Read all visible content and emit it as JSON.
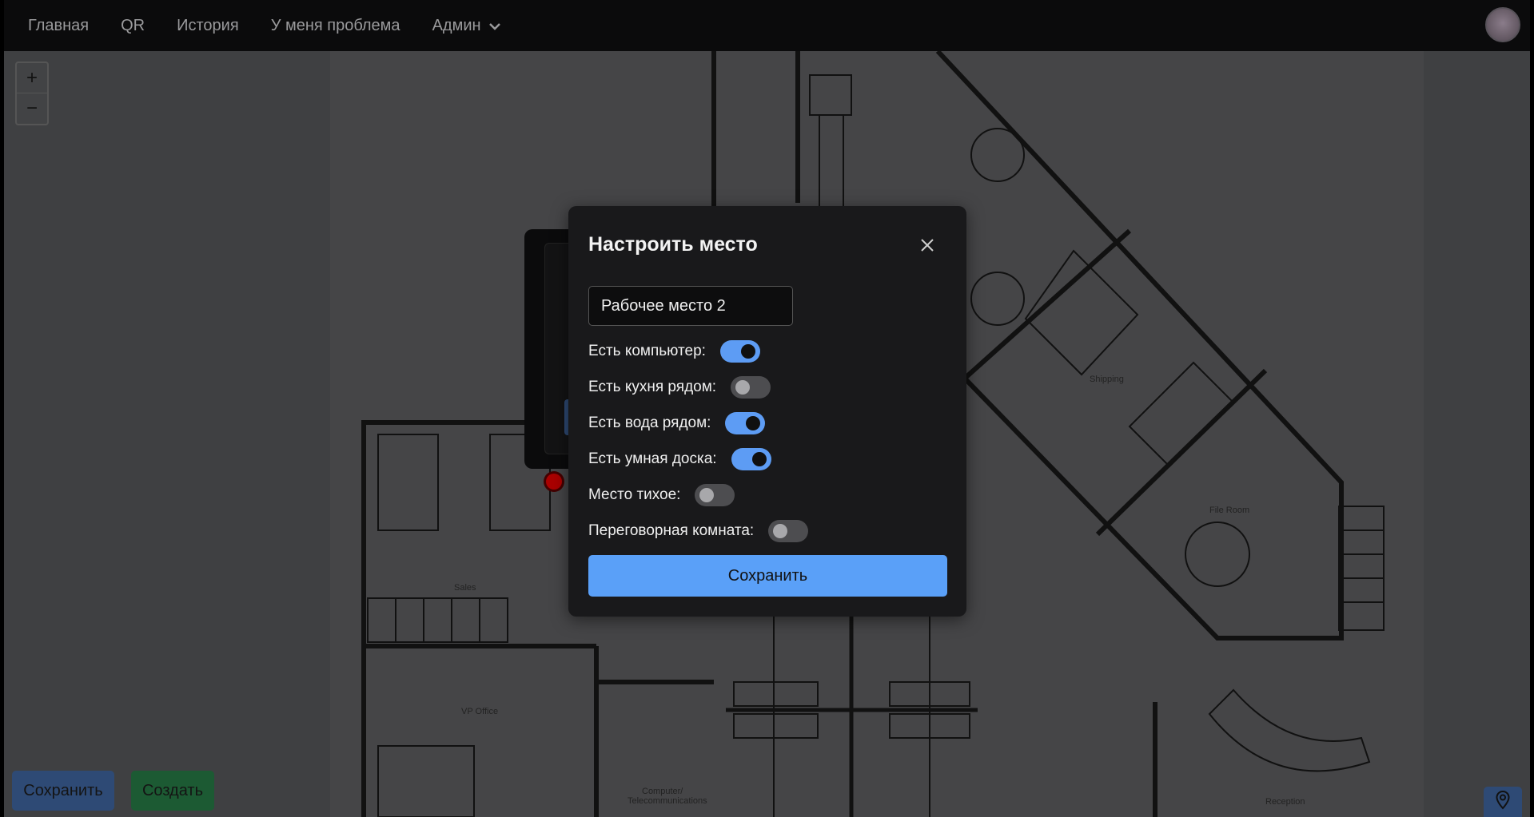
{
  "nav": {
    "items": [
      "Главная",
      "QR",
      "История",
      "У меня проблема"
    ],
    "admin_label": "Админ"
  },
  "zoom": {
    "plus": "+",
    "minus": "−"
  },
  "floorplan_labels": {
    "shipping": "Shipping",
    "file_room": "File Room",
    "sales": "Sales",
    "vp_office": "VP Office",
    "computer_telecom_1": "Computer/",
    "computer_telecom_2": "Telecommunications",
    "reception": "Reception"
  },
  "modal": {
    "title": "Настроить место",
    "name_value": "Рабочее место 2",
    "options": [
      {
        "label": "Есть компьютер:",
        "on": true
      },
      {
        "label": "Есть кухня рядом:",
        "on": false
      },
      {
        "label": "Есть вода рядом:",
        "on": true
      },
      {
        "label": "Есть умная доска:",
        "on": true
      },
      {
        "label": "Место тихое:",
        "on": false
      },
      {
        "label": "Переговорная комната:",
        "on": false
      }
    ],
    "save_label": "Сохранить"
  },
  "bottom": {
    "save_label": "Сохранить",
    "create_label": "Создать"
  },
  "colors": {
    "accent": "#5aa0f8",
    "toggle_on": "#5d9cf4",
    "modal_bg": "#19191b"
  }
}
